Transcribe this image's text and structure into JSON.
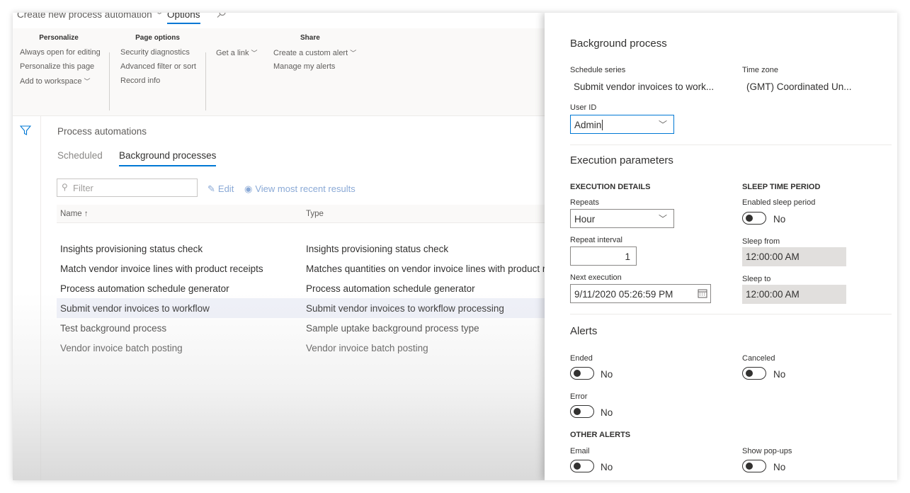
{
  "topbar": {
    "breadcrumb": "Create new process automation",
    "options_tab": "Options"
  },
  "ribbon": {
    "personalize": {
      "title": "Personalize",
      "items": [
        "Always open for editing",
        "Personalize this page",
        "Add to workspace"
      ]
    },
    "page_options": {
      "title": "Page options",
      "items": [
        "Security diagnostics",
        "Advanced filter or sort",
        "Record info"
      ]
    },
    "get_link": "Get a link",
    "share": {
      "title": "Share",
      "items": [
        "Create a custom alert",
        "Manage my alerts"
      ]
    }
  },
  "page": {
    "title": "Process automations",
    "tabs": [
      "Scheduled",
      "Background processes"
    ],
    "filter_placeholder": "Filter",
    "edit": "Edit",
    "view_results": "View most recent results"
  },
  "grid": {
    "columns": [
      "Name",
      "Type"
    ],
    "sort_glyph": "↑",
    "rows": [
      {
        "name": "Insights provisioning status check",
        "type": "Insights provisioning status check"
      },
      {
        "name": "Match vendor invoice lines with product receipts",
        "type": "Matches quantities on vendor invoice lines with product rece"
      },
      {
        "name": "Process automation schedule generator",
        "type": "Process automation schedule generator"
      },
      {
        "name": "Submit vendor invoices to workflow",
        "type": "Submit vendor invoices to workflow processing"
      },
      {
        "name": "Test background process",
        "type": "Sample uptake background process type"
      },
      {
        "name": "Vendor invoice batch posting",
        "type": "Vendor invoice batch posting"
      }
    ],
    "selected_row": 3
  },
  "panel": {
    "background_process": {
      "heading": "Background process",
      "schedule_series_label": "Schedule series",
      "schedule_series_value": "Submit vendor invoices to work...",
      "time_zone_label": "Time zone",
      "time_zone_value": "(GMT) Coordinated Un...",
      "user_id_label": "User ID",
      "user_id_value": "Admin"
    },
    "execution": {
      "heading": "Execution parameters",
      "details_heading": "EXECUTION DETAILS",
      "repeats_label": "Repeats",
      "repeats_value": "Hour",
      "repeat_interval_label": "Repeat interval",
      "repeat_interval_value": "1",
      "next_execution_label": "Next execution",
      "next_execution_value": "9/11/2020 05:26:59 PM",
      "sleep_heading": "SLEEP TIME PERIOD",
      "enabled_sleep_label": "Enabled sleep period",
      "enabled_sleep_value": "No",
      "sleep_from_label": "Sleep from",
      "sleep_from_value": "12:00:00 AM",
      "sleep_to_label": "Sleep to",
      "sleep_to_value": "12:00:00 AM"
    },
    "alerts": {
      "heading": "Alerts",
      "ended_label": "Ended",
      "ended_value": "No",
      "canceled_label": "Canceled",
      "canceled_value": "No",
      "error_label": "Error",
      "error_value": "No",
      "other_heading": "OTHER ALERTS",
      "email_label": "Email",
      "email_value": "No",
      "popups_label": "Show pop-ups",
      "popups_value": "No"
    }
  },
  "colors": {
    "accent": "#0078d4",
    "selected_row": "#eef0f8",
    "disabled_field": "#e1dfdd"
  }
}
